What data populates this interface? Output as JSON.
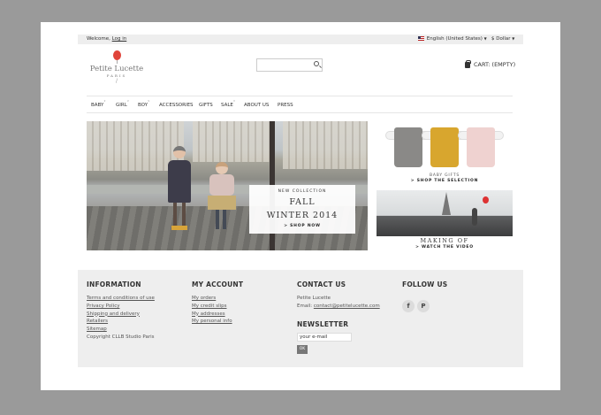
{
  "topbar": {
    "welcome": "Welcome,",
    "login": "Log in",
    "language": "English (United States)",
    "currency": "$ Dollar"
  },
  "brand": {
    "name": "Petite Lucette",
    "city": "PARIS"
  },
  "search": {
    "placeholder": ""
  },
  "cart": {
    "label": "CART: (EMPTY)"
  },
  "nav": {
    "items": [
      "BABY",
      "GIRL",
      "BOY",
      "ACCESSORIES",
      "GIFTS",
      "SALE",
      "ABOUT US",
      "PRESS"
    ]
  },
  "hero": {
    "kicker": "NEW COLLECTION",
    "headline1": "FALL",
    "headline2": "WINTER 2014",
    "cta": "> SHOP NOW"
  },
  "promo_gifts": {
    "label": "BABY GIFTS",
    "cta": "> SHOP THE SELECTION",
    "colors": [
      "#8a8987",
      "#d8a62e",
      "#efd2d0"
    ]
  },
  "promo_video": {
    "title": "MAKING OF",
    "cta": "> WATCH THE VIDEO"
  },
  "footer": {
    "information": {
      "heading": "INFORMATION",
      "links": [
        "Terms and conditions of use",
        "Privacy Policy",
        "Shipping and delivery",
        "Retailers",
        "Sitemap",
        "Copyright CLLB Studio Paris"
      ]
    },
    "account": {
      "heading": "MY ACCOUNT",
      "links": [
        "My orders",
        "My credit slips",
        "My addresses",
        "My personal info"
      ]
    },
    "contact": {
      "heading": "CONTACT US",
      "company": "Petite Lucette",
      "email_label": "Email:",
      "email": "contact@petitelucette.com"
    },
    "newsletter": {
      "heading": "NEWSLETTER",
      "input_value": "your e-mail",
      "button": "OK"
    },
    "follow": {
      "heading": "FOLLOW US",
      "icons": [
        "facebook-icon",
        "pinterest-icon"
      ],
      "facebook_glyph": "f",
      "pinterest_glyph": "P"
    }
  }
}
